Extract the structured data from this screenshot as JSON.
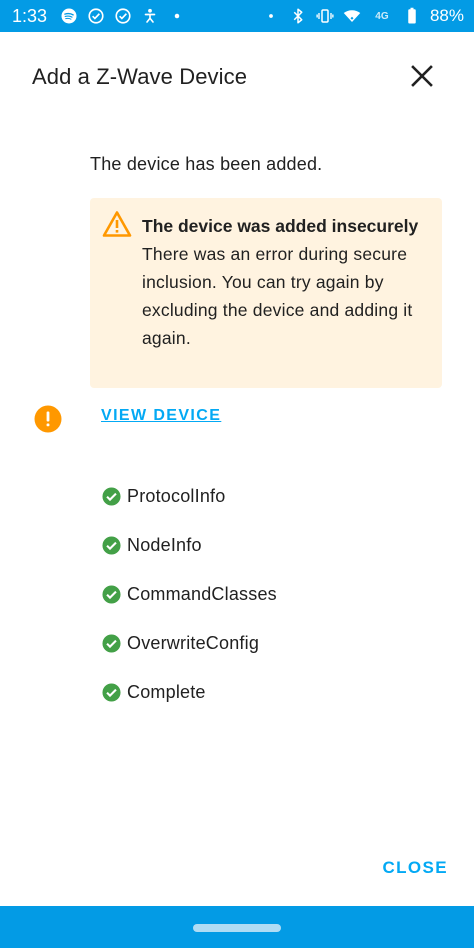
{
  "status_bar": {
    "time": "1:33",
    "battery_percent": "88%",
    "network_label": "4G"
  },
  "dialog": {
    "title": "Add a Z-Wave Device",
    "close_icon": "close-icon",
    "added_message": "The device has been added.",
    "warning": {
      "title": "The device was added insecurely",
      "message": "There was an error during secure inclusion. You can try again by excluding the device and adding it again."
    },
    "view_device_label": "VIEW DEVICE",
    "steps": [
      {
        "label": "ProtocolInfo",
        "status": "complete"
      },
      {
        "label": "NodeInfo",
        "status": "complete"
      },
      {
        "label": "CommandClasses",
        "status": "complete"
      },
      {
        "label": "OverwriteConfig",
        "status": "complete"
      },
      {
        "label": "Complete",
        "status": "complete"
      }
    ],
    "close_button_label": "CLOSE"
  },
  "colors": {
    "status_bar": "#039be5",
    "accent": "#03a9f4",
    "warning_bg": "#fff3e0",
    "warning_icon": "#ff9800",
    "success": "#43a047"
  }
}
